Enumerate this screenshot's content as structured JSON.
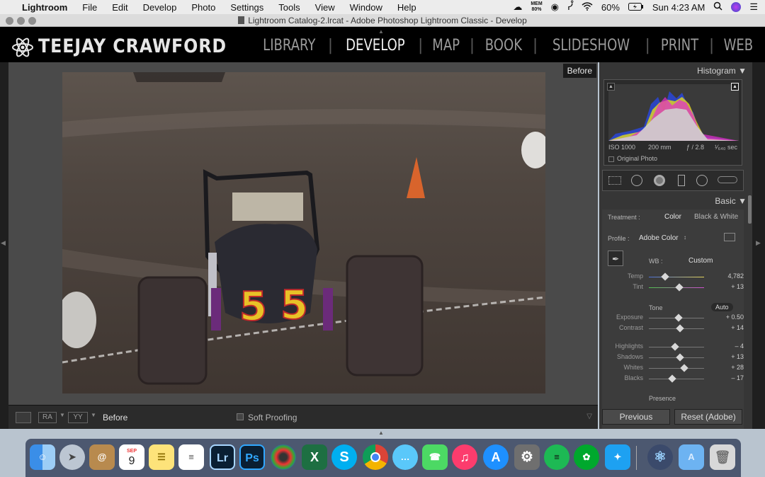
{
  "menubar": {
    "apple": "",
    "app": "Lightroom",
    "items": [
      "File",
      "Edit",
      "Develop",
      "Photo",
      "Settings",
      "Tools",
      "View",
      "Window",
      "Help"
    ],
    "mem": "MEM",
    "mem_value": "80%",
    "battery": "60%",
    "clock": "Sun 4:23 AM"
  },
  "window": {
    "title": "Lightroom Catalog-2.lrcat - Adobe Photoshop Lightroom Classic - Develop"
  },
  "header": {
    "brand": "TEEJAY CRAWFORD",
    "modules": [
      "LIBRARY",
      "DEVELOP",
      "MAP",
      "BOOK",
      "SLIDESHOW",
      "PRINT",
      "WEB"
    ],
    "active_module": "DEVELOP"
  },
  "viewer": {
    "before_label": "Before",
    "car_number": "5"
  },
  "toolbar": {
    "view_label": "Before",
    "soft_proofing": "Soft Proofing",
    "ra": "RA",
    "yy": "YY"
  },
  "histogram": {
    "title": "Histogram",
    "iso": "ISO 1000",
    "focal": "200 mm",
    "aperture": "ƒ / 2.8",
    "shutter": "¹⁄₆₄₀ sec",
    "original_photo": "Original Photo"
  },
  "basic": {
    "title": "Basic",
    "treatment_label": "Treatment :",
    "treatment_color": "Color",
    "treatment_bw": "Black & White",
    "profile_label": "Profile :",
    "profile_value": "Adobe Color",
    "wb_label": "WB :",
    "wb_value": "Custom",
    "tone_label": "Tone",
    "auto": "Auto",
    "presence": "Presence",
    "sliders": [
      {
        "label": "Temp",
        "value": "4,782",
        "pos": 0.29
      },
      {
        "label": "Tint",
        "value": "+ 13",
        "pos": 0.55
      },
      {
        "label": "Exposure",
        "value": "+ 0.50",
        "pos": 0.54
      },
      {
        "label": "Contrast",
        "value": "+ 14",
        "pos": 0.57
      },
      {
        "label": "Highlights",
        "value": "– 4",
        "pos": 0.48
      },
      {
        "label": "Shadows",
        "value": "+ 13",
        "pos": 0.56
      },
      {
        "label": "Whites",
        "value": "+ 28",
        "pos": 0.64
      },
      {
        "label": "Blacks",
        "value": "– 17",
        "pos": 0.42
      }
    ]
  },
  "buttons": {
    "previous": "Previous",
    "reset": "Reset (Adobe)"
  },
  "dock": {
    "calendar_month": "SEP",
    "calendar_day": "9",
    "apps": [
      "Finder",
      "Launchpad",
      "Contacts",
      "Calendar",
      "Notes",
      "Reminders",
      "Lightroom",
      "Photoshop",
      "DVD",
      "Excel",
      "Skype",
      "Chrome",
      "Messages",
      "FaceTime",
      "Music",
      "App Store",
      "System Preferences",
      "Spotify",
      "Evernote",
      "Twitter",
      "Atom",
      "Applications",
      "Trash"
    ],
    "lr": "Lr",
    "ps": "Ps",
    "xl": "X"
  }
}
